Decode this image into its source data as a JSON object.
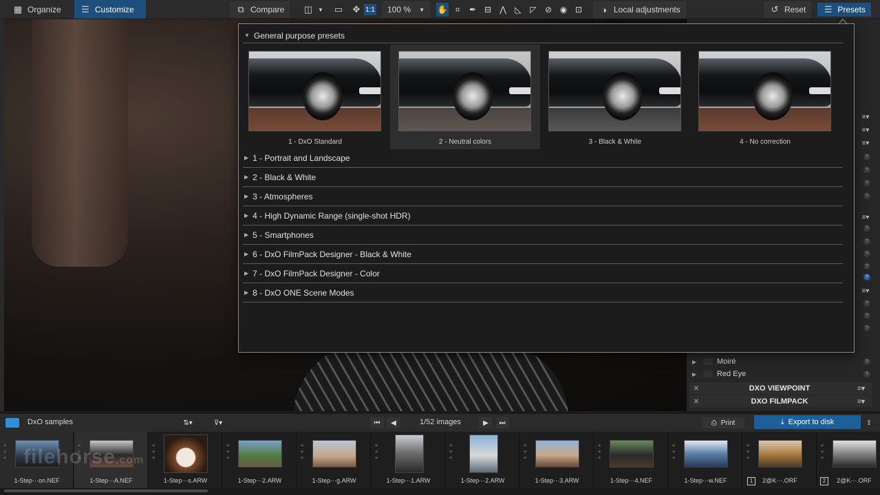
{
  "toolbar": {
    "organize": "Organize",
    "customize": "Customize",
    "compare": "Compare",
    "zoom_one_to_one": "1:1",
    "zoom_level": "100 %",
    "local_adjustments": "Local adjustments",
    "reset": "Reset",
    "presets": "Presets"
  },
  "presets_popup": {
    "section_title": "General purpose presets",
    "thumbnails": [
      {
        "label": "1 - DxO Standard",
        "selected": false,
        "tone": "color"
      },
      {
        "label": "2 - Neutral colors",
        "selected": true,
        "tone": "neutral"
      },
      {
        "label": "3 - Black & White",
        "selected": false,
        "tone": "bw"
      },
      {
        "label": "4 - No correction",
        "selected": false,
        "tone": "color"
      }
    ],
    "categories": [
      "1 - Portrait and Landscape",
      "2 - Black & White",
      "3 - Atmospheres",
      "4 - High Dynamic Range (single-shot HDR)",
      "5 - Smartphones",
      "6 - DxO FilmPack Designer - Black & White",
      "7 - DxO FilmPack Designer - Color",
      "8 - DxO ONE Scene Modes"
    ]
  },
  "right_panel": {
    "items": [
      "Moiré",
      "Red Eye"
    ],
    "sections": [
      "DXO VIEWPOINT",
      "DXO FILMPACK"
    ]
  },
  "navbar": {
    "folder": "DxO samples",
    "image_count": "1/52 images",
    "print": "Print",
    "export": "Export to disk"
  },
  "filmstrip": [
    {
      "label": "1-Step···on.NEF"
    },
    {
      "label": "1-Step···A.NEF"
    },
    {
      "label": "1-Step···s.ARW"
    },
    {
      "label": "1-Step···2.ARW"
    },
    {
      "label": "1-Step···g.ARW"
    },
    {
      "label": "1-Step···1.ARW"
    },
    {
      "label": "1-Step···2.ARW"
    },
    {
      "label": "1-Step···3.ARW"
    },
    {
      "label": "1-Step···4.NEF"
    },
    {
      "label": "1-Step···w.NEF"
    },
    {
      "label": "2@K···.ORF",
      "badge": "1"
    },
    {
      "label": "2@K···.ORF",
      "badge": "2"
    }
  ],
  "watermark": {
    "main": "filehorse",
    "suffix": ".com"
  }
}
